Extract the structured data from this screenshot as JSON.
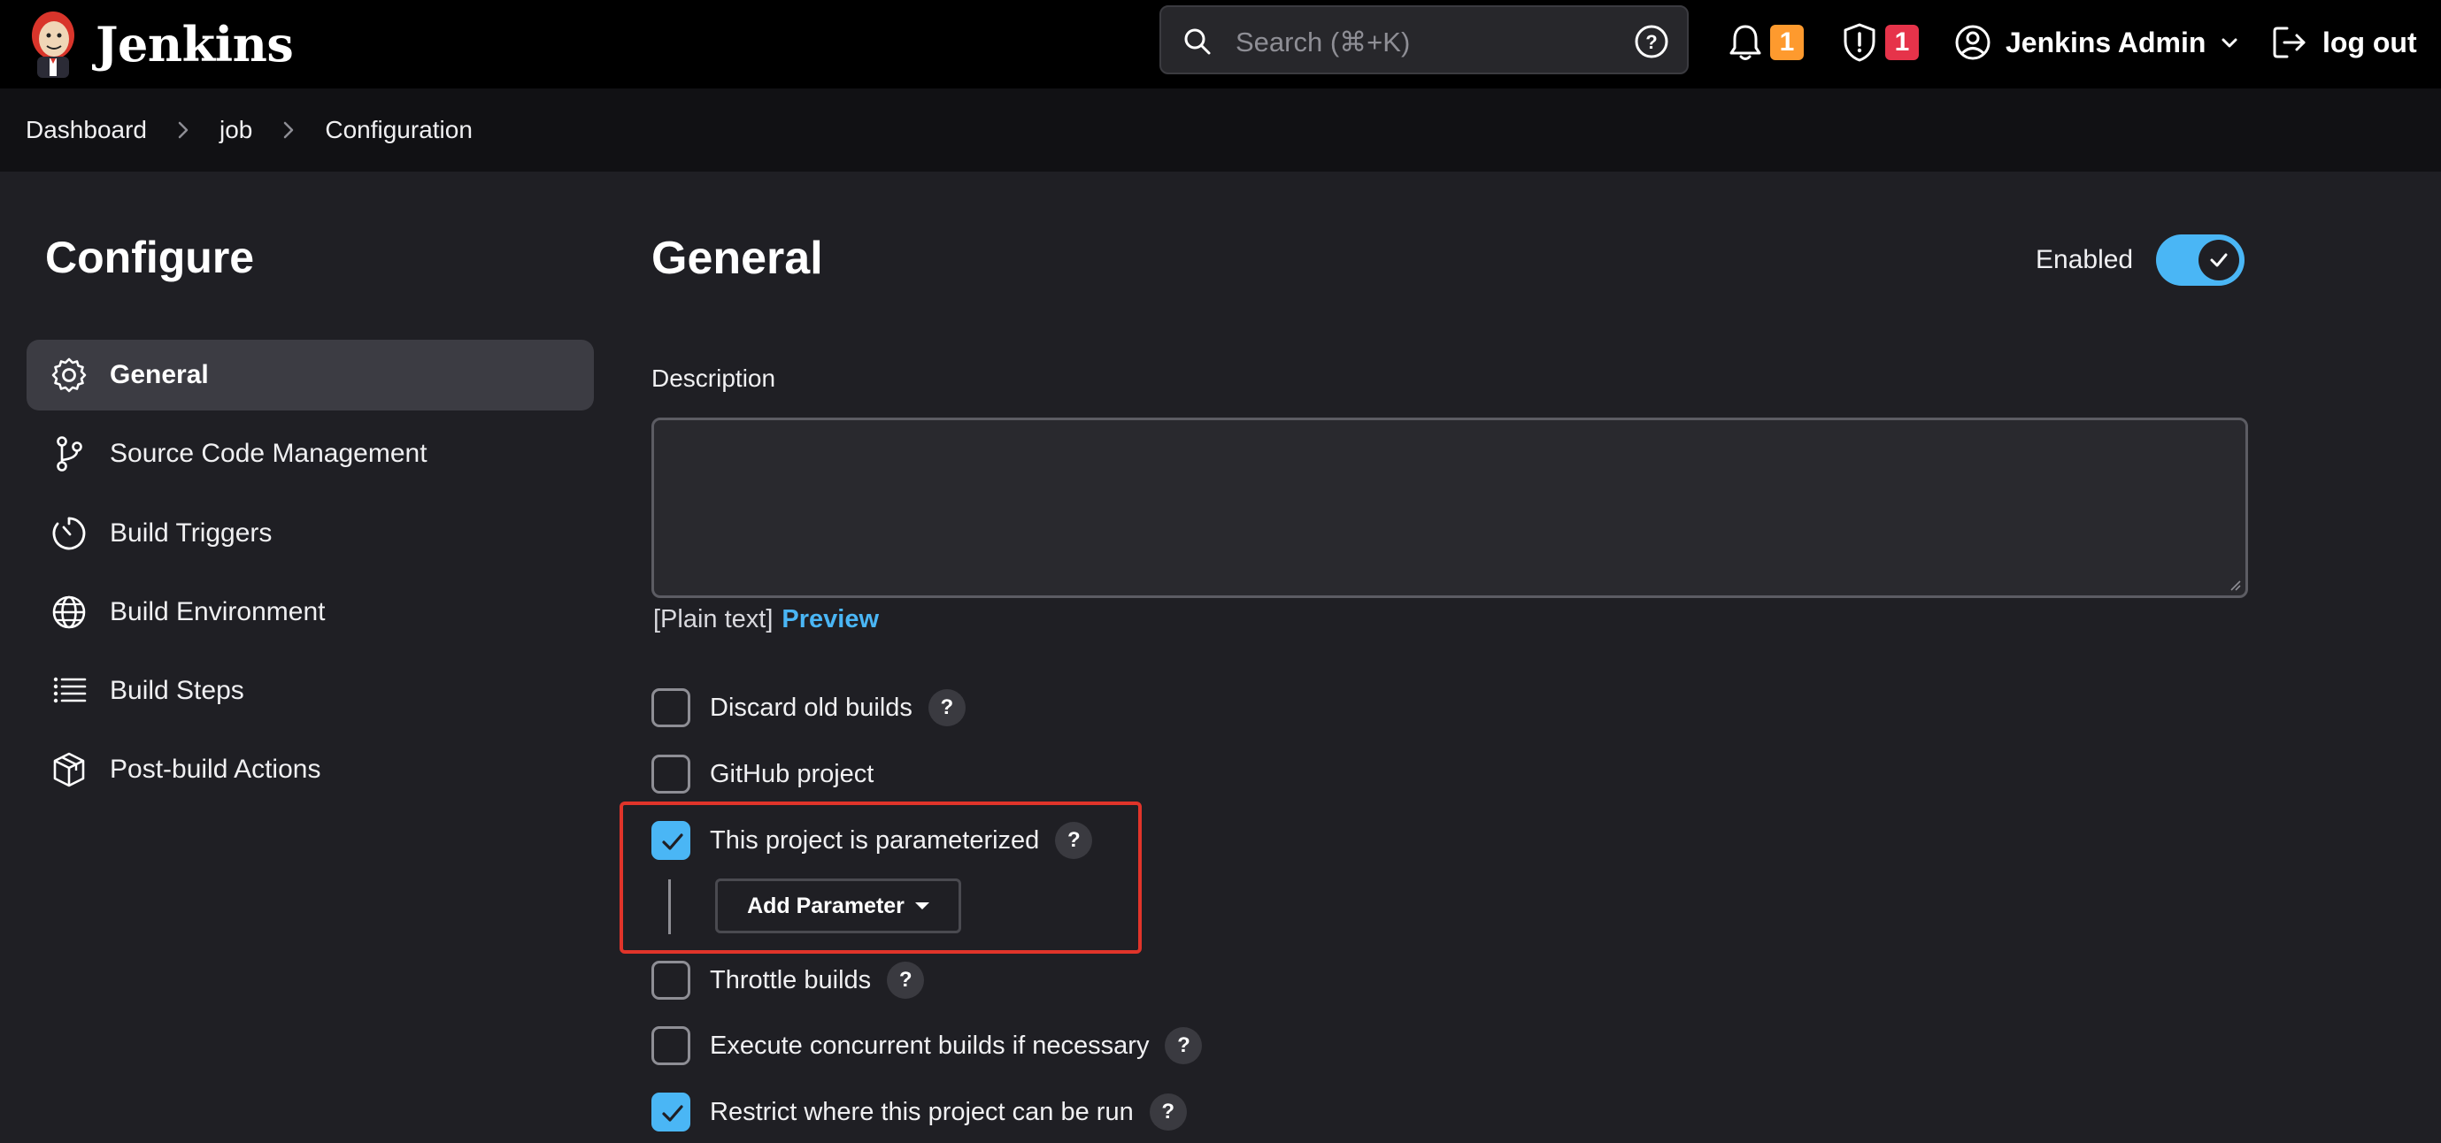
{
  "header": {
    "brand": "Jenkins",
    "search_placeholder": "Search (⌘+K)",
    "notifications_count": "1",
    "security_count": "1",
    "user_name": "Jenkins Admin",
    "logout_label": "log out",
    "icons": [
      "jenkins-logo",
      "search-icon",
      "help-icon",
      "bell-icon",
      "shield-icon",
      "user-icon",
      "chevron-down-icon",
      "logout-icon"
    ]
  },
  "breadcrumb": [
    "Dashboard",
    "job",
    "Configuration"
  ],
  "sidebar": {
    "title": "Configure",
    "items": [
      {
        "label": "General",
        "icon": "gear-icon",
        "active": true
      },
      {
        "label": "Source Code Management",
        "icon": "branch-icon",
        "active": false
      },
      {
        "label": "Build Triggers",
        "icon": "timer-icon",
        "active": false
      },
      {
        "label": "Build Environment",
        "icon": "globe-icon",
        "active": false
      },
      {
        "label": "Build Steps",
        "icon": "list-icon",
        "active": false
      },
      {
        "label": "Post-build Actions",
        "icon": "package-icon",
        "active": false
      }
    ]
  },
  "main": {
    "title": "General",
    "enabled_label": "Enabled",
    "enabled": true,
    "description_label": "Description",
    "description_value": "",
    "plain_text": "[Plain text]",
    "preview_link": "Preview",
    "options": [
      {
        "label": "Discard old builds",
        "checked": false,
        "help": "?"
      },
      {
        "label": "GitHub project",
        "checked": false
      },
      {
        "label": "This project is parameterized",
        "checked": true,
        "help": "?"
      },
      {
        "label": "Throttle builds",
        "checked": false,
        "help": "?"
      },
      {
        "label": "Execute concurrent builds if necessary",
        "checked": false,
        "help": "?"
      },
      {
        "label": "Restrict where this project can be run",
        "checked": true,
        "help": "?"
      }
    ],
    "add_parameter_label": "Add Parameter"
  },
  "colors": {
    "accent": "#4ab6f5",
    "highlight": "#e0342a",
    "warning_badge": "#fe9a2e",
    "danger_badge": "#e6334a"
  }
}
